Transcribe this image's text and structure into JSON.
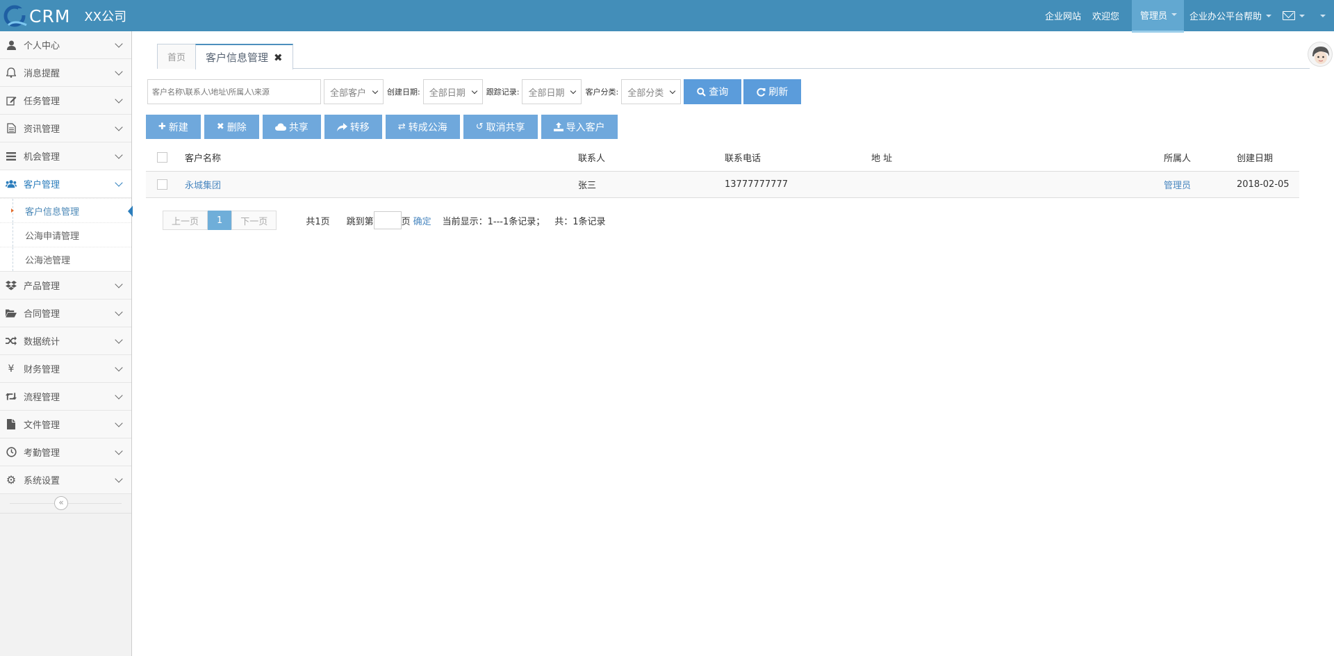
{
  "header": {
    "brand": "CRM",
    "company": "XX公司",
    "links": [
      "企业网站",
      "欢迎您"
    ],
    "admin": "管理员",
    "help": "企业办公平台帮助"
  },
  "sidebar": {
    "items": [
      {
        "label": "个人中心",
        "icon": "user-icon"
      },
      {
        "label": "消息提醒",
        "icon": "bell-icon"
      },
      {
        "label": "任务管理",
        "icon": "edit-icon"
      },
      {
        "label": "资讯管理",
        "icon": "document-icon"
      },
      {
        "label": "机会管理",
        "icon": "list-icon"
      },
      {
        "label": "客户管理",
        "icon": "users-icon"
      },
      {
        "label": "产品管理",
        "icon": "dropbox-icon"
      },
      {
        "label": "合同管理",
        "icon": "folder-open-icon"
      },
      {
        "label": "数据统计",
        "icon": "random-icon"
      },
      {
        "label": "财务管理",
        "icon": "yen-icon"
      },
      {
        "label": "流程管理",
        "icon": "retweet-icon"
      },
      {
        "label": "文件管理",
        "icon": "file-icon"
      },
      {
        "label": "考勤管理",
        "icon": "clock-icon"
      },
      {
        "label": "系统设置",
        "icon": "gear-icon"
      }
    ],
    "submenu": [
      "客户信息管理",
      "公海申请管理",
      "公海池管理"
    ]
  },
  "tabs": {
    "home": "首页",
    "current": "客户信息管理"
  },
  "filters": {
    "search_placeholder": "客户名称\\联系人\\地址\\所属人\\来源",
    "customer_scope": "全部客户",
    "created_label": "创建日期:",
    "created_value": "全部日期",
    "followup_label": "跟踪记录:",
    "followup_value": "全部日期",
    "category_label": "客户分类:",
    "category_value": "全部分类",
    "query": "查询",
    "refresh": "刷新"
  },
  "actions": {
    "new": "新建",
    "delete": "删除",
    "share": "共享",
    "transfer": "转移",
    "to_public": "转成公海",
    "cancel_share": "取消共享",
    "import": "导入客户"
  },
  "table": {
    "headers": [
      "客户名称",
      "联系人",
      "联系电话",
      "地 址",
      "所属人",
      "创建日期"
    ],
    "rows": [
      {
        "name": "永城集团",
        "contact": "张三",
        "phone": "13777777777",
        "address": "",
        "owner": "管理员",
        "created": "2018-02-05"
      }
    ]
  },
  "pager": {
    "prev": "上一页",
    "current": "1",
    "next": "下一页",
    "total_pages": "共1页",
    "jump_prefix": "跳到第",
    "jump_suffix": "页",
    "confirm": "确定",
    "showing": "当前显示：1---1条记录；",
    "total": "共：1条记录"
  },
  "colors": {
    "navbar": "#438eb9",
    "accent": "#6fb3e0",
    "button": "#6fa8dc",
    "link": "#4b88c0"
  }
}
